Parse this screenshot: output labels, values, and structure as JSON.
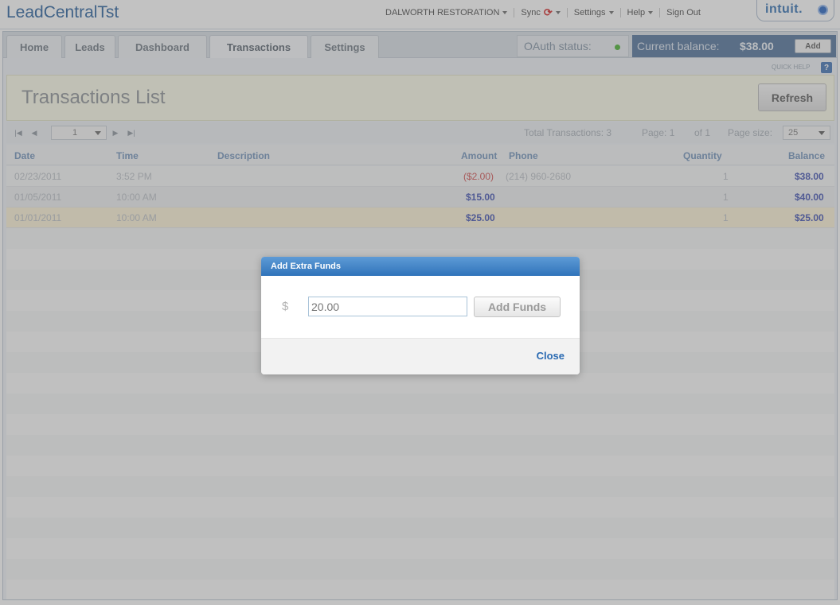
{
  "app": {
    "title": "LeadCentralTst"
  },
  "topnav": {
    "company": "DALWORTH RESTORATION",
    "sync": "Sync",
    "settings": "Settings",
    "help": "Help",
    "signout": "Sign Out",
    "brand": "intuit."
  },
  "tabs": [
    {
      "label": "Home"
    },
    {
      "label": "Leads"
    },
    {
      "label": "Dashboard"
    },
    {
      "label": "Transactions"
    },
    {
      "label": "Settings"
    }
  ],
  "status": {
    "oauth_label": "OAuth status:",
    "balance_label": "Current balance:",
    "balance_value": "$38.00",
    "add_label": "Add",
    "quick_help": "QUICK HELP",
    "help_icon_text": "?"
  },
  "page": {
    "title": "Transactions List",
    "refresh_label": "Refresh"
  },
  "pager": {
    "current_page": "1",
    "total_transactions": "Total Transactions: 3",
    "page_label": "Page: 1",
    "of_label": "of 1",
    "page_size_label": "Page size:",
    "page_size": "25"
  },
  "table": {
    "columns": [
      "Date",
      "Time",
      "Description",
      "Amount",
      "Phone",
      "Quantity",
      "Balance"
    ],
    "rows": [
      {
        "date": "02/23/2011",
        "time": "3:52 PM",
        "description": "",
        "amount": "($2.00)",
        "phone": "(214) 960-2680",
        "quantity": "1",
        "balance": "$38.00",
        "negative": true
      },
      {
        "date": "01/05/2011",
        "time": "10:00 AM",
        "description": "",
        "amount": "$15.00",
        "phone": "",
        "quantity": "1",
        "balance": "$40.00",
        "negative": false
      },
      {
        "date": "01/01/2011",
        "time": "10:00 AM",
        "description": "",
        "amount": "$25.00",
        "phone": "",
        "quantity": "1",
        "balance": "$25.00",
        "negative": false
      }
    ]
  },
  "dialog": {
    "title": "Add Extra Funds",
    "currency": "$",
    "amount_value": "20.00",
    "add_funds_label": "Add Funds",
    "close_label": "Close"
  },
  "colors": {
    "brand_blue": "#1f5a9a",
    "dialog_header": "#2f73ba",
    "negative_amount": "#d04a4a",
    "positive_amount": "#3c4db0",
    "oauth_ok": "#43b02a"
  }
}
